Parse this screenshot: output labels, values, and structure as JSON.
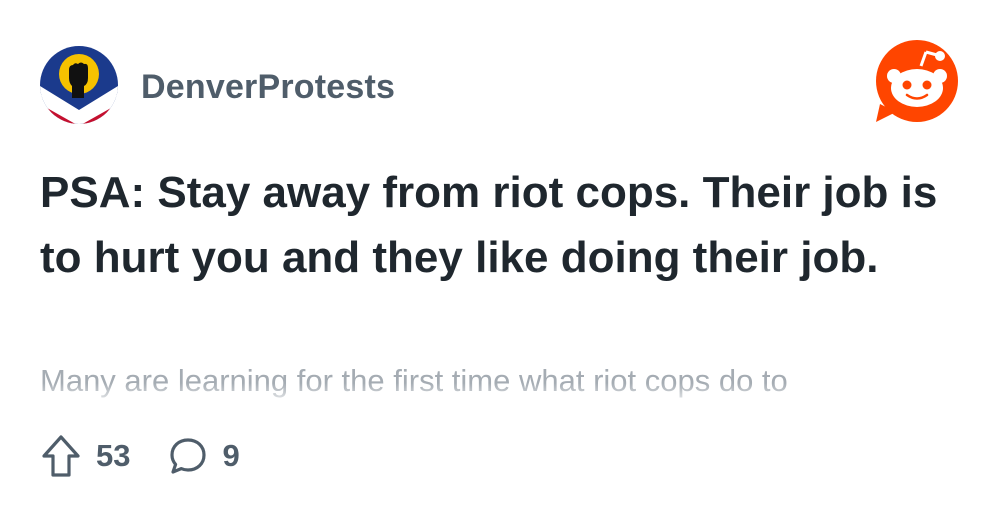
{
  "subreddit": {
    "name": "DenverProtests",
    "icon": "raised-fist-icon"
  },
  "brand": {
    "icon": "reddit-snoo-icon",
    "color": "#ff4500"
  },
  "post": {
    "title": "PSA: Stay away from riot cops. Their job is to hurt you and they like doing their job.",
    "body_preview": "Many are learning for the first time what riot cops do to"
  },
  "actions": {
    "upvotes": "53",
    "upvote_icon": "upvote-arrow-icon",
    "comments": "9",
    "comment_icon": "comment-bubble-icon"
  },
  "colors": {
    "title": "#1f272e",
    "meta": "#4f5d6a",
    "body_fade": "#a5acb3",
    "flag_red": "#c4102f",
    "flag_blue": "#1b3a8c",
    "flag_gold": "#f6c200"
  }
}
